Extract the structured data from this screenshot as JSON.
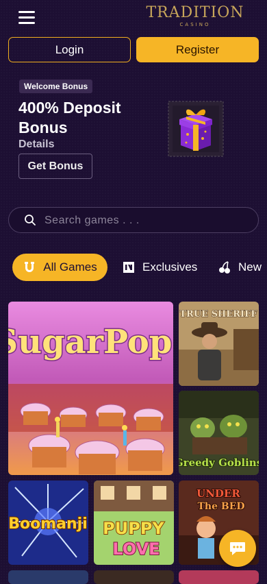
{
  "header": {
    "logo_main": "TRADITION",
    "logo_sub": "CASINO"
  },
  "auth": {
    "login_label": "Login",
    "register_label": "Register"
  },
  "promo": {
    "badge": "Welcome Bonus",
    "title": "400% Deposit Bonus",
    "details_label": "Details",
    "button_label": "Get Bonus"
  },
  "search": {
    "placeholder": "Search games . . ."
  },
  "tabs": [
    {
      "label": "All Games",
      "icon": "horseshoe-icon",
      "active": true
    },
    {
      "label": "Exclusives",
      "icon": "exclusive-icon",
      "active": false
    },
    {
      "label": "New",
      "icon": "cherries-icon",
      "active": false
    }
  ],
  "games": [
    {
      "title": "SugarPop!"
    },
    {
      "title": "The True Sheriff"
    },
    {
      "title": "Greedy Goblins"
    },
    {
      "title": "Boomanji"
    },
    {
      "title": "Puppy Love"
    },
    {
      "title": "Under the Bed"
    }
  ],
  "colors": {
    "background": "#1d0f33",
    "accent": "#f6b526",
    "logo_gold": "#c8a65a"
  }
}
